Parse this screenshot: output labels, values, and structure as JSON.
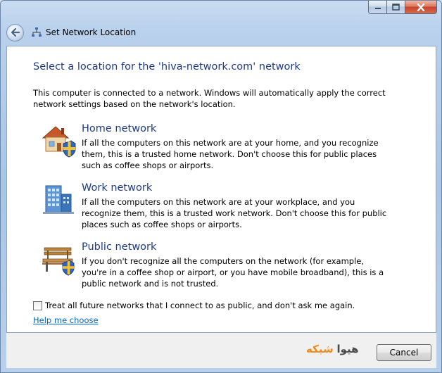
{
  "window": {
    "title": "Set Network Location",
    "caption_buttons": [
      "minimize-icon",
      "maximize-icon",
      "close-icon"
    ]
  },
  "main": {
    "heading": "Select a location for the 'hiva-network.com' network",
    "intro": "This computer is connected to a network. Windows will automatically apply the correct network settings based on the network's location.",
    "options": [
      {
        "title": "Home network",
        "description": "If all the computers on this network are at your home, and you recognize them, this is a trusted home network.  Don't choose this for public places such as coffee shops or airports.",
        "icon": "home-network-icon"
      },
      {
        "title": "Work network",
        "description": "If all the computers on this network are at your workplace, and you recognize them, this is a trusted work network.  Don't choose this for public places such as coffee shops or airports.",
        "icon": "work-network-icon"
      },
      {
        "title": "Public network",
        "description": "If you don't recognize all the computers on the network (for example, you're in a coffee shop or airport, or you have mobile broadband), this is a public network and is not trusted.",
        "icon": "public-network-icon"
      }
    ],
    "checkbox_label": "Treat all future networks that I connect to as public, and don't ask me again.",
    "checkbox_checked": false,
    "help_link": "Help me choose"
  },
  "footer": {
    "logo_part1": "هیوا",
    "logo_part2": "شبکه",
    "cancel_label": "Cancel"
  },
  "colors": {
    "heading": "#1e3a8a",
    "link": "#0066cc",
    "logo_accent": "#f08a1a"
  }
}
